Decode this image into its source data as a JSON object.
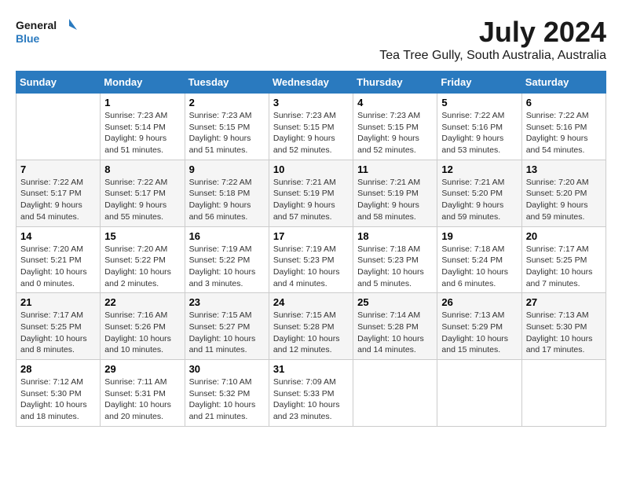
{
  "header": {
    "logo_line1": "General",
    "logo_line2": "Blue",
    "month_title": "July 2024",
    "location": "Tea Tree Gully, South Australia, Australia"
  },
  "weekdays": [
    "Sunday",
    "Monday",
    "Tuesday",
    "Wednesday",
    "Thursday",
    "Friday",
    "Saturday"
  ],
  "weeks": [
    [
      {
        "day": "",
        "sunrise": "",
        "sunset": "",
        "daylight": "",
        "empty": true
      },
      {
        "day": "1",
        "sunrise": "Sunrise: 7:23 AM",
        "sunset": "Sunset: 5:14 PM",
        "daylight": "Daylight: 9 hours and 51 minutes."
      },
      {
        "day": "2",
        "sunrise": "Sunrise: 7:23 AM",
        "sunset": "Sunset: 5:15 PM",
        "daylight": "Daylight: 9 hours and 51 minutes."
      },
      {
        "day": "3",
        "sunrise": "Sunrise: 7:23 AM",
        "sunset": "Sunset: 5:15 PM",
        "daylight": "Daylight: 9 hours and 52 minutes."
      },
      {
        "day": "4",
        "sunrise": "Sunrise: 7:23 AM",
        "sunset": "Sunset: 5:15 PM",
        "daylight": "Daylight: 9 hours and 52 minutes."
      },
      {
        "day": "5",
        "sunrise": "Sunrise: 7:22 AM",
        "sunset": "Sunset: 5:16 PM",
        "daylight": "Daylight: 9 hours and 53 minutes."
      },
      {
        "day": "6",
        "sunrise": "Sunrise: 7:22 AM",
        "sunset": "Sunset: 5:16 PM",
        "daylight": "Daylight: 9 hours and 54 minutes."
      }
    ],
    [
      {
        "day": "7",
        "sunrise": "Sunrise: 7:22 AM",
        "sunset": "Sunset: 5:17 PM",
        "daylight": "Daylight: 9 hours and 54 minutes."
      },
      {
        "day": "8",
        "sunrise": "Sunrise: 7:22 AM",
        "sunset": "Sunset: 5:17 PM",
        "daylight": "Daylight: 9 hours and 55 minutes."
      },
      {
        "day": "9",
        "sunrise": "Sunrise: 7:22 AM",
        "sunset": "Sunset: 5:18 PM",
        "daylight": "Daylight: 9 hours and 56 minutes."
      },
      {
        "day": "10",
        "sunrise": "Sunrise: 7:21 AM",
        "sunset": "Sunset: 5:19 PM",
        "daylight": "Daylight: 9 hours and 57 minutes."
      },
      {
        "day": "11",
        "sunrise": "Sunrise: 7:21 AM",
        "sunset": "Sunset: 5:19 PM",
        "daylight": "Daylight: 9 hours and 58 minutes."
      },
      {
        "day": "12",
        "sunrise": "Sunrise: 7:21 AM",
        "sunset": "Sunset: 5:20 PM",
        "daylight": "Daylight: 9 hours and 59 minutes."
      },
      {
        "day": "13",
        "sunrise": "Sunrise: 7:20 AM",
        "sunset": "Sunset: 5:20 PM",
        "daylight": "Daylight: 9 hours and 59 minutes."
      }
    ],
    [
      {
        "day": "14",
        "sunrise": "Sunrise: 7:20 AM",
        "sunset": "Sunset: 5:21 PM",
        "daylight": "Daylight: 10 hours and 0 minutes."
      },
      {
        "day": "15",
        "sunrise": "Sunrise: 7:20 AM",
        "sunset": "Sunset: 5:22 PM",
        "daylight": "Daylight: 10 hours and 2 minutes."
      },
      {
        "day": "16",
        "sunrise": "Sunrise: 7:19 AM",
        "sunset": "Sunset: 5:22 PM",
        "daylight": "Daylight: 10 hours and 3 minutes."
      },
      {
        "day": "17",
        "sunrise": "Sunrise: 7:19 AM",
        "sunset": "Sunset: 5:23 PM",
        "daylight": "Daylight: 10 hours and 4 minutes."
      },
      {
        "day": "18",
        "sunrise": "Sunrise: 7:18 AM",
        "sunset": "Sunset: 5:23 PM",
        "daylight": "Daylight: 10 hours and 5 minutes."
      },
      {
        "day": "19",
        "sunrise": "Sunrise: 7:18 AM",
        "sunset": "Sunset: 5:24 PM",
        "daylight": "Daylight: 10 hours and 6 minutes."
      },
      {
        "day": "20",
        "sunrise": "Sunrise: 7:17 AM",
        "sunset": "Sunset: 5:25 PM",
        "daylight": "Daylight: 10 hours and 7 minutes."
      }
    ],
    [
      {
        "day": "21",
        "sunrise": "Sunrise: 7:17 AM",
        "sunset": "Sunset: 5:25 PM",
        "daylight": "Daylight: 10 hours and 8 minutes."
      },
      {
        "day": "22",
        "sunrise": "Sunrise: 7:16 AM",
        "sunset": "Sunset: 5:26 PM",
        "daylight": "Daylight: 10 hours and 10 minutes."
      },
      {
        "day": "23",
        "sunrise": "Sunrise: 7:15 AM",
        "sunset": "Sunset: 5:27 PM",
        "daylight": "Daylight: 10 hours and 11 minutes."
      },
      {
        "day": "24",
        "sunrise": "Sunrise: 7:15 AM",
        "sunset": "Sunset: 5:28 PM",
        "daylight": "Daylight: 10 hours and 12 minutes."
      },
      {
        "day": "25",
        "sunrise": "Sunrise: 7:14 AM",
        "sunset": "Sunset: 5:28 PM",
        "daylight": "Daylight: 10 hours and 14 minutes."
      },
      {
        "day": "26",
        "sunrise": "Sunrise: 7:13 AM",
        "sunset": "Sunset: 5:29 PM",
        "daylight": "Daylight: 10 hours and 15 minutes."
      },
      {
        "day": "27",
        "sunrise": "Sunrise: 7:13 AM",
        "sunset": "Sunset: 5:30 PM",
        "daylight": "Daylight: 10 hours and 17 minutes."
      }
    ],
    [
      {
        "day": "28",
        "sunrise": "Sunrise: 7:12 AM",
        "sunset": "Sunset: 5:30 PM",
        "daylight": "Daylight: 10 hours and 18 minutes."
      },
      {
        "day": "29",
        "sunrise": "Sunrise: 7:11 AM",
        "sunset": "Sunset: 5:31 PM",
        "daylight": "Daylight: 10 hours and 20 minutes."
      },
      {
        "day": "30",
        "sunrise": "Sunrise: 7:10 AM",
        "sunset": "Sunset: 5:32 PM",
        "daylight": "Daylight: 10 hours and 21 minutes."
      },
      {
        "day": "31",
        "sunrise": "Sunrise: 7:09 AM",
        "sunset": "Sunset: 5:33 PM",
        "daylight": "Daylight: 10 hours and 23 minutes."
      },
      {
        "day": "",
        "sunrise": "",
        "sunset": "",
        "daylight": "",
        "empty": true
      },
      {
        "day": "",
        "sunrise": "",
        "sunset": "",
        "daylight": "",
        "empty": true
      },
      {
        "day": "",
        "sunrise": "",
        "sunset": "",
        "daylight": "",
        "empty": true
      }
    ]
  ]
}
